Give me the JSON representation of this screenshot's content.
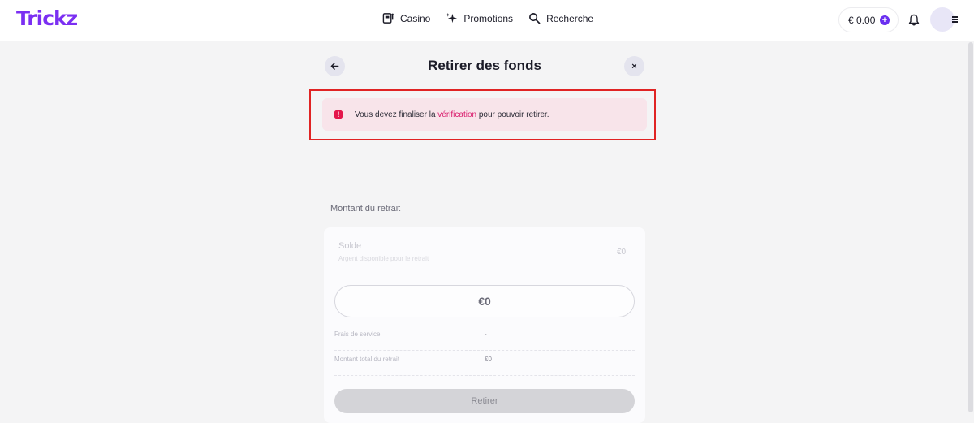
{
  "brand": {
    "logo_text": "Trickz",
    "logo_color": "#7b2ff2"
  },
  "nav": {
    "items": [
      {
        "label": "Casino",
        "icon": "slot-machine-icon"
      },
      {
        "label": "Promotions",
        "icon": "sparkles-icon"
      },
      {
        "label": "Recherche",
        "icon": "search-icon"
      }
    ]
  },
  "header": {
    "balance": "€ 0.00",
    "add_funds_icon": "plus-icon",
    "notifications_icon": "bell-icon",
    "menu_icon": "menu-icon"
  },
  "page": {
    "title": "Retirer des fonds",
    "back_icon": "arrow-left-icon",
    "close_icon": "close-icon",
    "close_symbol": "×"
  },
  "alert": {
    "icon_symbol": "!",
    "text_before": "Vous devez finaliser la ",
    "link_text": "vérification",
    "text_after": " pour pouvoir retirer.",
    "background": "#f8e4ea",
    "accent": "#e4174c"
  },
  "withdrawal": {
    "section_label": "Montant du retrait",
    "balance_label": "Solde",
    "balance_sublabel": "Argent disponible pour le retrait",
    "balance_value": "€0",
    "amount_value": "€0",
    "fees_label": "Frais de service",
    "fees_value": "-",
    "total_label": "Montant total du retrait",
    "total_value": "€0",
    "submit_label": "Retirer"
  }
}
